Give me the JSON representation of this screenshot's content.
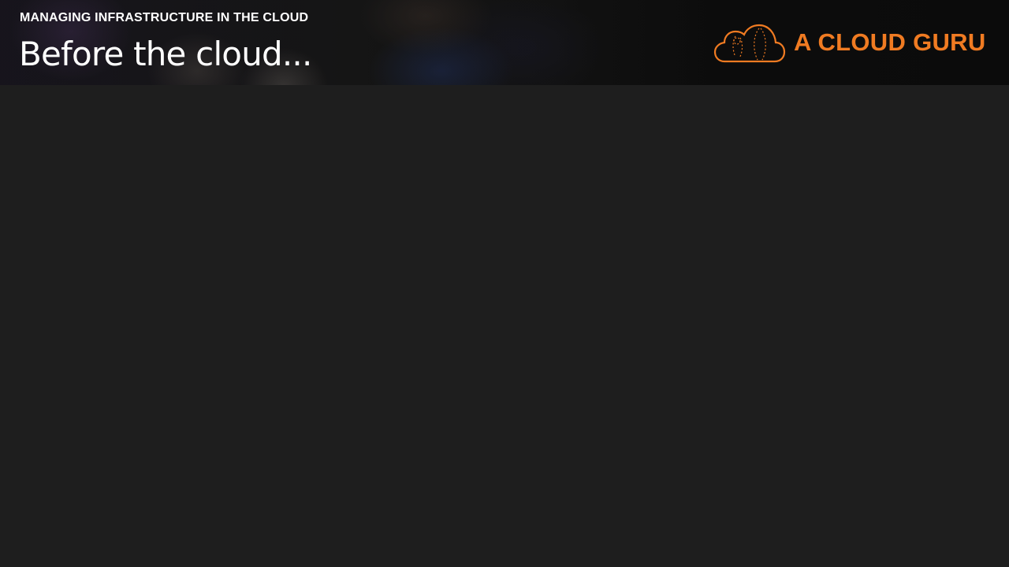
{
  "header": {
    "kicker": "MANAGING INFRASTRUCTURE IN THE CLOUD",
    "title": "Before the cloud..."
  },
  "brand": {
    "name": "A CLOUD GURU",
    "icon": "cloud-guru-logo-icon",
    "accent_color": "#f07b22"
  },
  "colors": {
    "background": "#1e1e1e",
    "header_background": "#141414",
    "text": "#ffffff"
  }
}
